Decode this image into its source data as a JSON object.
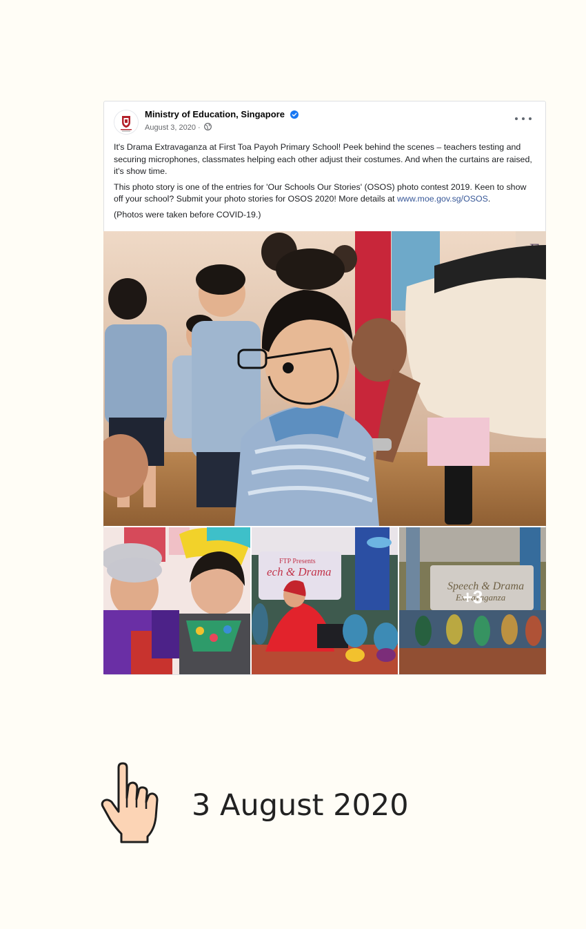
{
  "post": {
    "author": "Ministry of Education, Singapore",
    "date": "August 3, 2020 · ",
    "paragraphs": [
      "It's Drama Extravaganza at First Toa Payoh Primary School! Peek behind the scenes – teachers testing and securing microphones, classmates helping each other adjust their costumes. And when the curtains are raised, it's show time.",
      "This photo story is one of the entries for 'Our Schools Our Stories' (OSOS) photo contest 2019. Keen to show off your school? Submit your photo stories for OSOS 2020! More details at ",
      "(Photos were taken before COVID-19.)"
    ],
    "link_text": "www.moe.gov.sg/OSOS",
    "link_suffix": ".",
    "more_photos_label": "+3"
  },
  "caption": {
    "date": "3 August 2020"
  },
  "colors": {
    "background": "#fffdf6",
    "link": "#385898",
    "verified": "#1877f2",
    "crest": "#b3202a"
  }
}
